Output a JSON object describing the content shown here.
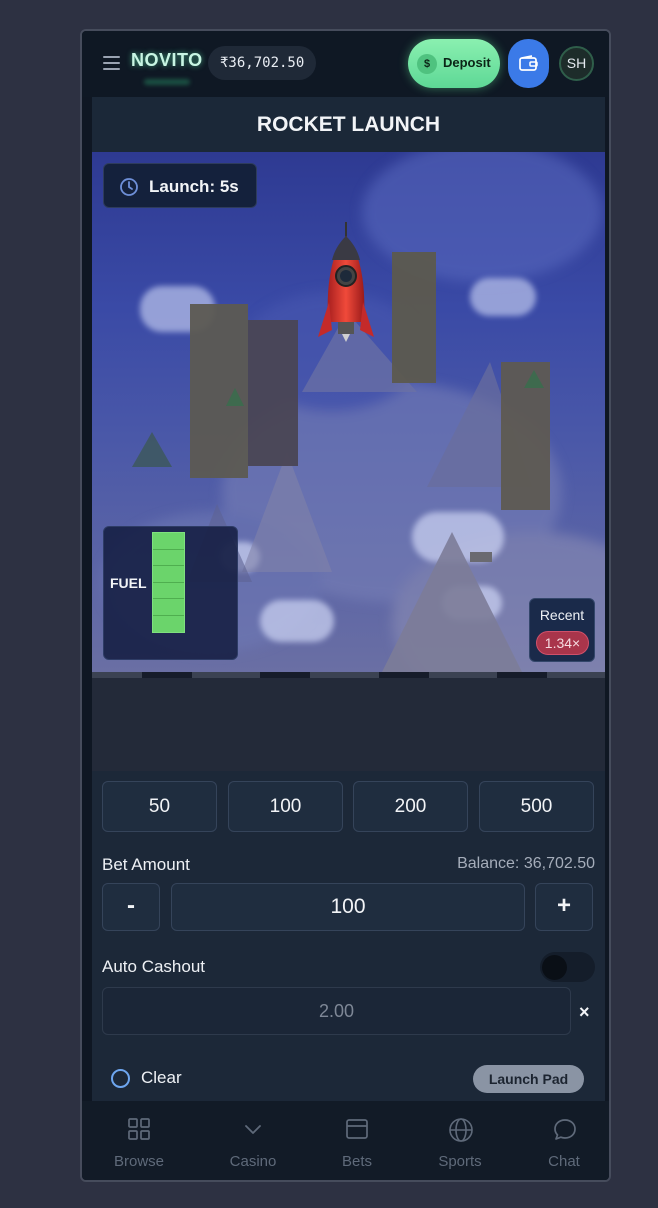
{
  "header": {
    "brand": "NOVITO",
    "balance": "₹36,702.50",
    "deposit_symbol": "$",
    "deposit_label": "Deposit",
    "avatar_initials": "SH"
  },
  "game": {
    "title": "ROCKET LAUNCH",
    "launch_timer": "Launch: 5s",
    "fuel_label": "FUEL",
    "fuel_level": 1.0,
    "recent_label": "Recent",
    "recent_multipliers": [
      "1.34×"
    ]
  },
  "controls": {
    "quick_amounts": [
      "50",
      "100",
      "200",
      "500"
    ],
    "bet_amount_label": "Bet Amount",
    "balance_text": "Balance: 36,702.50",
    "decrement_label": "-",
    "increment_label": "+",
    "bet_amount_value": "100",
    "auto_cashout_label": "Auto Cashout",
    "auto_cashout_enabled": false,
    "auto_cashout_placeholder": "2.00",
    "clear_icon": "×",
    "clear_label": "Clear",
    "launch_pad_label": "Launch Pad"
  },
  "nav": {
    "items": [
      {
        "label": "Browse",
        "icon": "grid-icon"
      },
      {
        "label": "Casino",
        "icon": "chevron-down-icon"
      },
      {
        "label": "Bets",
        "icon": "ticket-icon"
      },
      {
        "label": "Sports",
        "icon": "globe-icon"
      },
      {
        "label": "Chat",
        "icon": "chat-bubble-icon"
      }
    ]
  },
  "colors": {
    "accent_green": "#5ed896",
    "accent_blue": "#3b7ae8",
    "recent_loss": "#a9354b",
    "background": "#2d3142"
  }
}
